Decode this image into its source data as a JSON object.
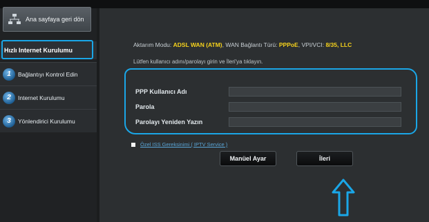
{
  "sidebar": {
    "home_label": "Ana sayfaya geri dön",
    "menu_title": "Hızlı Internet Kurulumu",
    "steps": [
      {
        "num": "1",
        "label": "Bağlantıyı Kontrol Edin"
      },
      {
        "num": "2",
        "label": "Internet Kurulumu"
      },
      {
        "num": "3",
        "label": "Yönlendirici Kurulumu"
      }
    ]
  },
  "main": {
    "mode_label": "Aktarım Modu:",
    "mode_value": "ADSL WAN (ATM)",
    "wan_label": ", WAN Bağlantı Türü:",
    "wan_value": "PPPoE",
    "vpi_label": ", VPI/VCI:",
    "vpi_value": "8/35, LLC",
    "instruction": "Lütfen kullanıcı adını/parolayı girin ve İleri'ya tıklayın.",
    "fields": [
      {
        "label": "PPP Kullanıcı Adı",
        "value": ""
      },
      {
        "label": "Parola",
        "value": ""
      },
      {
        "label": "Parolayı Yeniden Yazın",
        "value": ""
      }
    ],
    "checkbox_label": "Özel ISS Gereksinimi ( IPTV Service )",
    "manual_button": "Manüel Ayar",
    "next_button": "İleri"
  },
  "colors": {
    "accent_highlight": "#1aa7e8",
    "value_highlight": "#f6d21c"
  }
}
